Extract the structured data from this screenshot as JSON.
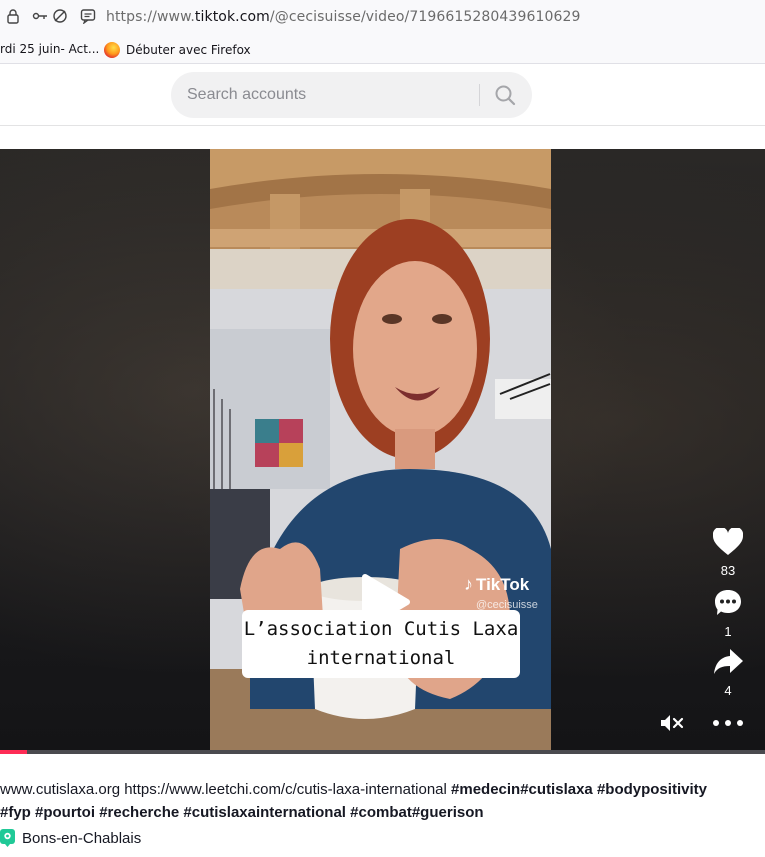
{
  "browser": {
    "url_prefix": "https://www.",
    "url_domain": "tiktok.com",
    "url_path": "/@cecisuisse/video/7196615280439610629",
    "bookmarks": [
      {
        "label": "rdi 25 juin- Act..."
      },
      {
        "label": "Débuter avec Firefox",
        "icon": "firefox-icon"
      }
    ]
  },
  "header": {
    "search_placeholder": "Search accounts"
  },
  "video": {
    "caption_line1": "L’association Cutis Laxa",
    "caption_line2": "international",
    "watermark": "TikTok",
    "watermark_user": "@cecisuisse",
    "progress_fraction": 0.035
  },
  "actions": {
    "likes": "83",
    "comments": "1",
    "shares": "4"
  },
  "description": {
    "plain": "www.cutislaxa.org https://www.leetchi.com/c/cutis-laxa-international ",
    "tags_line1": [
      "#medecin",
      "#cutislaxa",
      "#bodypositivity"
    ],
    "tags_line2": [
      "#fyp",
      "#pourtoi",
      "#recherche",
      "#cutislaxainternational",
      "#combat",
      "#guerison"
    ]
  },
  "location": "Bons-en-Chablais",
  "colors": {
    "accent": "#fe2c55",
    "location_pin": "#20c997"
  }
}
